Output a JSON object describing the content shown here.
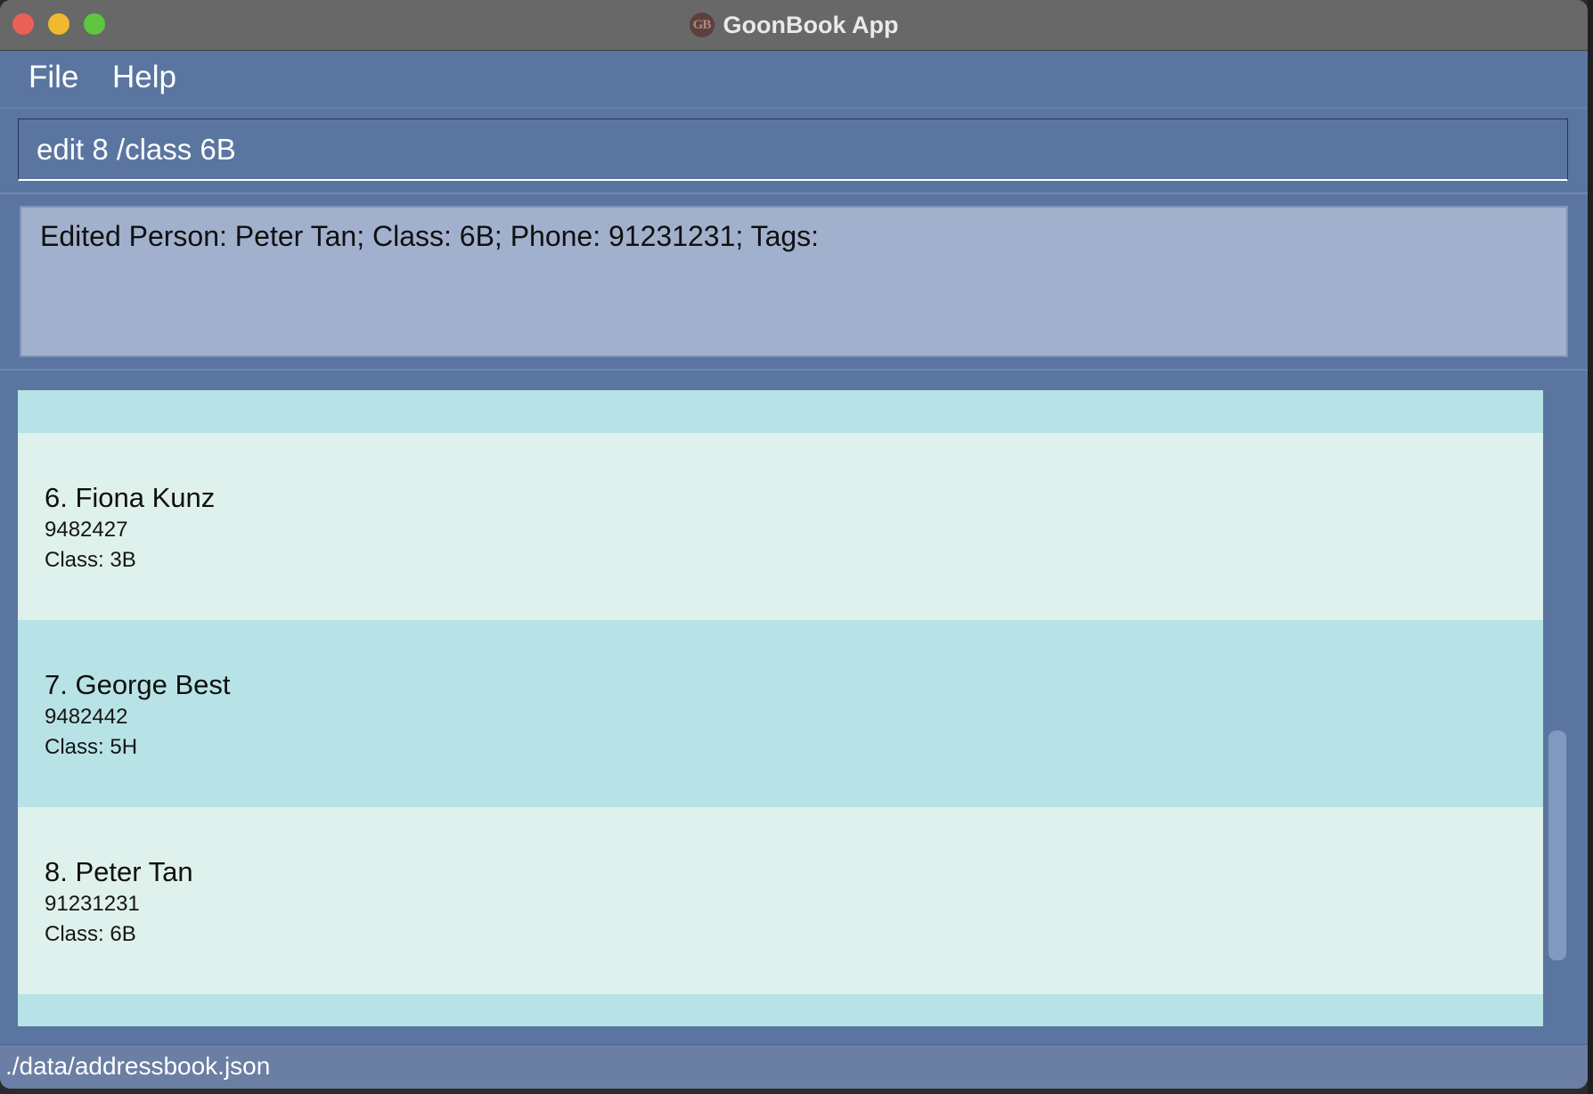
{
  "window": {
    "title": "GoonBook App",
    "logo_text": "GB"
  },
  "menu": {
    "file_label": "File",
    "help_label": "Help"
  },
  "command": {
    "value": "edit 8 /class 6B"
  },
  "result": {
    "message": "Edited Person: Peter Tan; Class: 6B; Phone: 91231231; Tags:"
  },
  "persons": [
    {
      "name": "6. Fiona Kunz",
      "phone": "9482427",
      "class_label": "Class: 3B"
    },
    {
      "name": "7. George Best",
      "phone": "9482442",
      "class_label": "Class: 5H"
    },
    {
      "name": "8. Peter Tan",
      "phone": "91231231",
      "class_label": "Class: 6B"
    }
  ],
  "status": {
    "file_path": "./data/addressbook.json"
  },
  "colors": {
    "window_bg": "#5a76a0",
    "result_bg": "#a1b1cd",
    "row_even": "#b8e3e6",
    "row_odd": "#dff1ec",
    "status_bg": "#6b7ea3"
  }
}
